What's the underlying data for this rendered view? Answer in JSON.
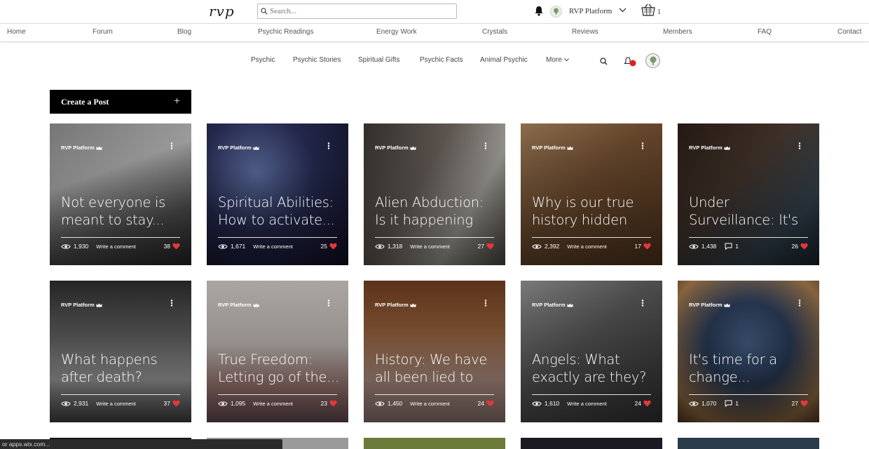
{
  "header": {
    "logo": "rvp",
    "search_placeholder": "Search...",
    "user_name": "RVP Platform",
    "cart_count": "1"
  },
  "main_nav": [
    "Home",
    "Forum",
    "Blog",
    "Psychic Readings",
    "Energy Work",
    "Crystals",
    "Reviews",
    "Members",
    "FAQ",
    "Contact"
  ],
  "category_nav": [
    "Psychic",
    "Psychic Stories",
    "Spiritual Gifts",
    "Psychic Facts",
    "Animal Psychic",
    "More"
  ],
  "notification_badge": "",
  "create_post_label": "Create a Post",
  "create_post_symbol": "+",
  "write_comment_label": "Write a comment",
  "author_name": "RVP Platform",
  "posts": [
    {
      "title": "Not everyone is meant to stay...",
      "views": "1,930",
      "likes": "38",
      "comments": null,
      "bg": "linear-gradient(160deg,#8a8a8a 0%,#bfbfbf 35%,#5a5a5a 70%,#2a2a2a 100%)"
    },
    {
      "title": "Spiritual Abilities: How to activate...",
      "views": "1,671",
      "likes": "25",
      "comments": null,
      "bg": "radial-gradient(circle at 35% 35%,#6b7db8 0%,#2a2f5a 45%,#120f25 100%)"
    },
    {
      "title": "Alien Abduction: Is it happening to...",
      "views": "1,318",
      "likes": "27",
      "comments": null,
      "bg": "linear-gradient(120deg,#3a3632 0%,#6f6660 40%,#b9b6b0 70%,#57514a 100%)"
    },
    {
      "title": "Why is our true history hidden fro...",
      "views": "2,392",
      "likes": "17",
      "comments": null,
      "bg": "linear-gradient(135deg,#a4805a 0%,#7a5434 45%,#5c3c22 100%)"
    },
    {
      "title": "Under Surveillance: It's begun",
      "views": "1,438",
      "likes": "26",
      "comments": "1",
      "bg": "linear-gradient(135deg,#2b1d16 0%,#4a3a30 40%,#3a4a58 75%,#1d2833 100%)"
    },
    {
      "title": "What happens after death?",
      "views": "2,931",
      "likes": "37",
      "comments": null,
      "bg": "linear-gradient(180deg,#2a2a2a 0%,#6a6a6a 40%,#b5b5b5 70%,#4d4d4d 100%)"
    },
    {
      "title": "True Freedom: Letting go of the...",
      "views": "1,095",
      "likes": "23",
      "comments": null,
      "bg": "linear-gradient(180deg,#c7c2bf 0%,#d6cfcb 45%,#b58a84 75%,#7a5a60 100%)"
    },
    {
      "title": "History: We have all been lied to",
      "views": "1,450",
      "likes": "24",
      "comments": null,
      "bg": "linear-gradient(180deg,#6b3a1e 0%,#a0673e 35%,#c9a596 70%,#a98b85 100%)"
    },
    {
      "title": "Angels: What exactly are they?",
      "views": "1,610",
      "likes": "24",
      "comments": null,
      "bg": "linear-gradient(135deg,#8f8f8f 0%,#5d5d5d 45%,#3a3a3a 100%)"
    },
    {
      "title": "It's time for a change...",
      "views": "1,070",
      "likes": "27",
      "comments": "1",
      "bg": "radial-gradient(circle at 50% 45%,#4d6a95 0%,#2e4160 40%,#a3784a 80%,#5a4028 100%)"
    }
  ],
  "status_text": "or apps.wix.com..."
}
